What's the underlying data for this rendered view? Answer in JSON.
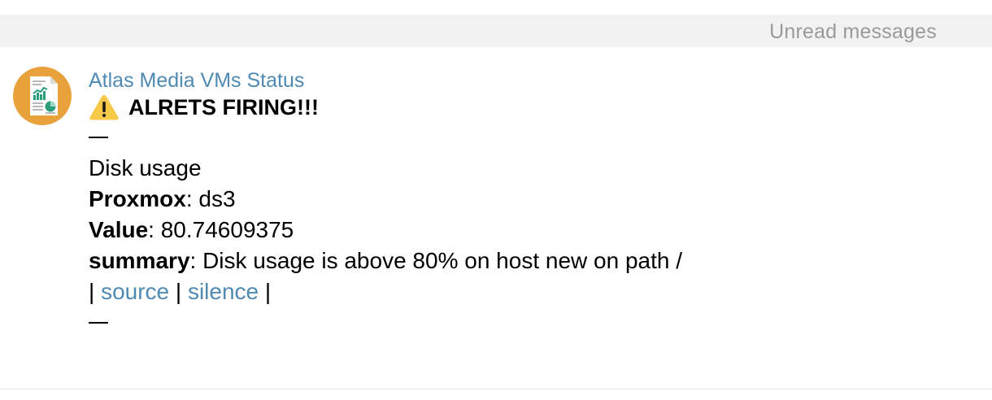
{
  "unread": {
    "label": "Unread messages"
  },
  "message": {
    "sender": "Atlas Media VMs Status",
    "avatar_icon": "report-document-icon",
    "alert_icon": "warning-icon",
    "title": "ALRETS FIRING!!!",
    "dash": "—",
    "alert_name": "Disk usage",
    "fields": {
      "proxmox_label": "Proxmox",
      "proxmox_value": ": ds3",
      "value_label": "Value",
      "value_value": ": 80.74609375",
      "summary_label": "summary",
      "summary_value": ": Disk usage is above 80% on host new on path /"
    },
    "links": {
      "sep_left": "| ",
      "source": "source",
      "sep_mid": " | ",
      "silence": "silence",
      "sep_right": " |"
    }
  },
  "colors": {
    "link": "#4f8ab3",
    "avatar_bg": "#e9a23b",
    "unread_bg": "#f2f2f2",
    "unread_text": "#9a9a9a"
  }
}
